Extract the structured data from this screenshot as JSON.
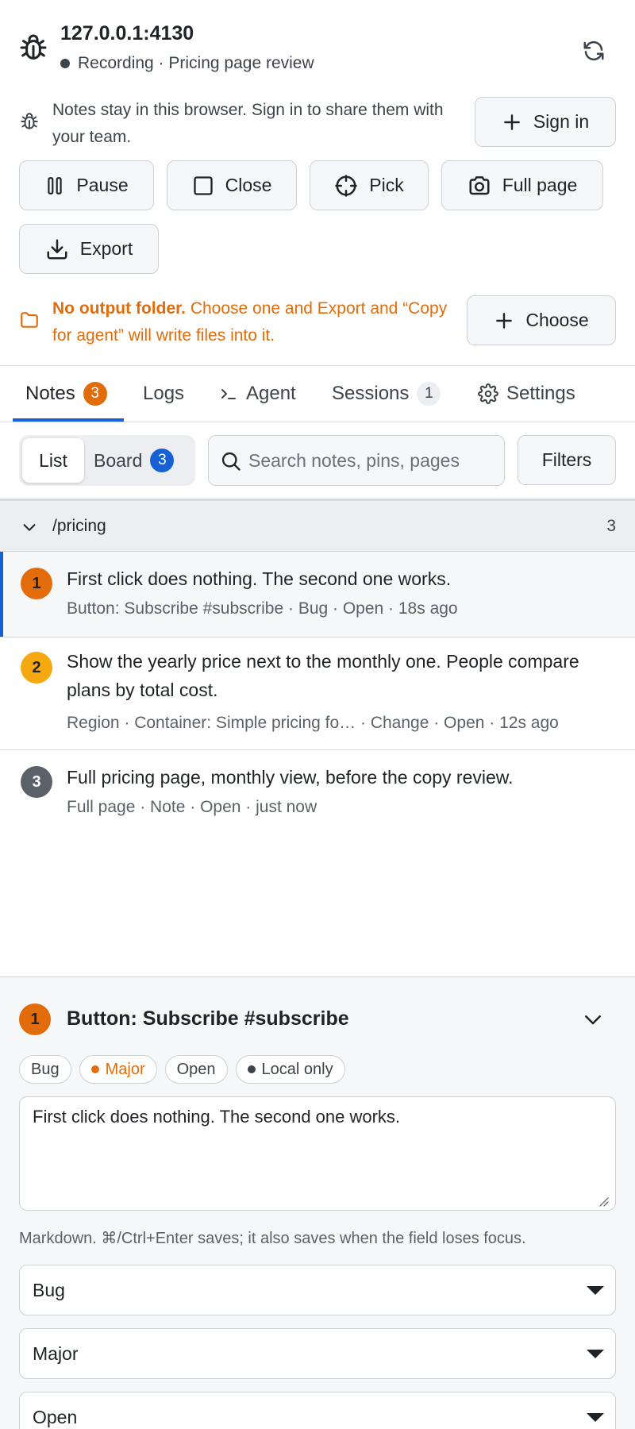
{
  "header": {
    "host": "127.0.0.1:4130",
    "recording": "Recording · Pricing page review"
  },
  "notice": {
    "text": "Notes stay in this browser. Sign in to share them with your team.",
    "sign_in": "Sign in"
  },
  "toolbar": {
    "pause": "Pause",
    "close": "Close",
    "pick": "Pick",
    "full_page": "Full page",
    "export": "Export"
  },
  "warning": {
    "bold": "No output folder.",
    "text": "Choose one and Export and “Copy for agent” will write files into it.",
    "choose": "Choose"
  },
  "tabs": {
    "notes": "Notes",
    "notes_count": "3",
    "logs": "Logs",
    "agent": "Agent",
    "sessions": "Sessions",
    "sessions_count": "1",
    "settings": "Settings"
  },
  "view": {
    "list": "List",
    "board": "Board",
    "board_count": "3",
    "search_placeholder": "Search notes, pins, pages",
    "filters": "Filters"
  },
  "group": {
    "path": "/pricing",
    "count": "3"
  },
  "notes": [
    {
      "num": "1",
      "text": "First click does nothing. The second one works.",
      "meta": "Button: Subscribe #subscribe · Bug · Open · 18s ago"
    },
    {
      "num": "2",
      "text": "Show the yearly price next to the monthly one. People compare plans by total cost.",
      "meta": "Region · Container: Simple pricing fo… · Change · Open · 12s ago"
    },
    {
      "num": "3",
      "text": "Full pricing page, monthly view, before the copy review.",
      "meta": "Full page · Note · Open · just now"
    }
  ],
  "detail": {
    "num": "1",
    "title": "Button: Subscribe #subscribe",
    "chips": {
      "type": "Bug",
      "severity": "Major",
      "status": "Open",
      "scope": "Local only"
    },
    "body": "First click does nothing. The second one works.",
    "hint": "Markdown. ⌘/Ctrl+Enter saves; it also saves when the field loses focus.",
    "type_select": "Bug",
    "severity_select": "Major",
    "status_select": "Open"
  },
  "colors": {
    "accent": "#1560d4",
    "warning": "#e36c0a",
    "pin_2": "#f5a80f",
    "pin_3": "#5b6168"
  }
}
